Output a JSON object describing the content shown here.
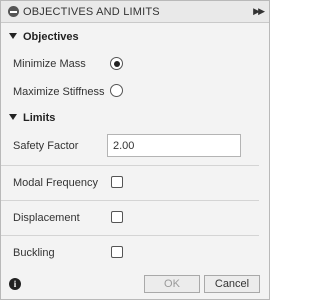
{
  "titlebar": {
    "title": "OBJECTIVES AND LIMITS",
    "collapse_icon": "minus-circle-icon",
    "expand_icon": "double-chevron-right-icon"
  },
  "objectives": {
    "header": "Objectives",
    "options": [
      {
        "label": "Minimize Mass",
        "selected": true
      },
      {
        "label": "Maximize Stiffness",
        "selected": false
      }
    ]
  },
  "limits": {
    "header": "Limits",
    "safety_factor": {
      "label": "Safety Factor",
      "value": "2.00"
    },
    "checks": [
      {
        "label": "Modal Frequency",
        "checked": false
      },
      {
        "label": "Displacement",
        "checked": false
      },
      {
        "label": "Buckling",
        "checked": false
      }
    ]
  },
  "footer": {
    "info_icon": "info-icon",
    "ok_label": "OK",
    "cancel_label": "Cancel"
  },
  "colors": {
    "panel_bg": "#f3f3f3",
    "titlebar_bg": "#e9e9e9",
    "disabled_text": "#9a9a9a"
  }
}
